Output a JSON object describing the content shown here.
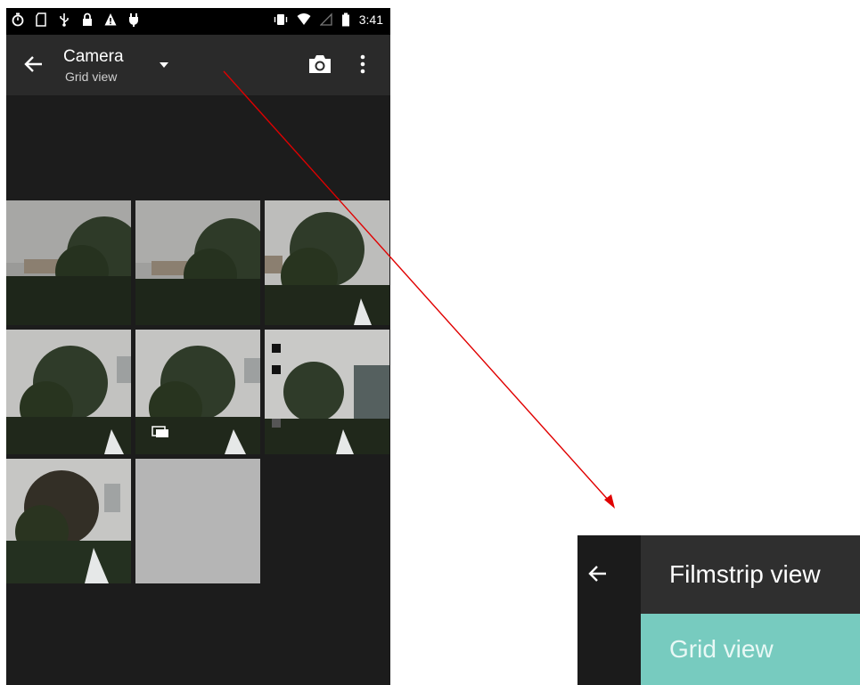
{
  "statusbar": {
    "time": "3:41",
    "left_icons": [
      "stopwatch-icon",
      "sim-icon",
      "usb-icon",
      "lock-icon",
      "warning-icon",
      "plug-icon"
    ],
    "right_icons": [
      "vibrate-icon",
      "wifi-icon",
      "no-signal-icon",
      "battery-icon"
    ]
  },
  "toolbar": {
    "title": "Camera",
    "subtitle": "Grid view",
    "icons": [
      "back-arrow-icon",
      "dropdown-arrow-icon",
      "camera-icon",
      "more-vert-icon"
    ]
  },
  "grid": {
    "photos": [
      {
        "name": "photo-1"
      },
      {
        "name": "photo-2"
      },
      {
        "name": "photo-3"
      },
      {
        "name": "photo-4"
      },
      {
        "name": "photo-5-burst"
      },
      {
        "name": "photo-6"
      },
      {
        "name": "photo-7"
      },
      {
        "name": "photo-8-placeholder"
      }
    ]
  },
  "zoom_menu": {
    "items": [
      {
        "label": "Filmstrip view",
        "selected": false
      },
      {
        "label": "Grid view",
        "selected": true
      }
    ]
  },
  "colors": {
    "status_bar": "#000000",
    "toolbar": "#2a2a2a",
    "background": "#1c1c1c",
    "menu_selected": "#77cbbf",
    "annotation_arrow": "#e00000"
  }
}
